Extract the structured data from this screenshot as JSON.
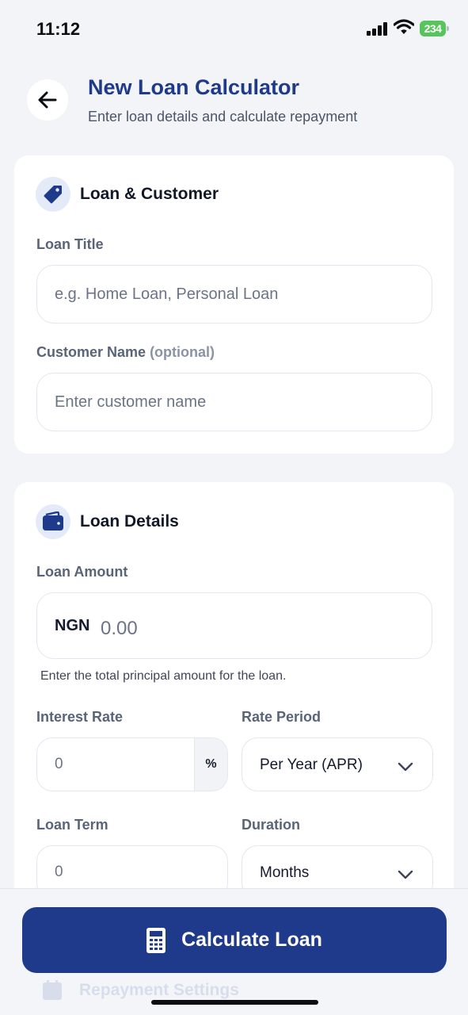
{
  "status_bar": {
    "time": "11:12",
    "battery": "234"
  },
  "header": {
    "title": "New Loan Calculator",
    "subtitle": "Enter loan details and calculate repayment",
    "back_icon": "arrow-left-icon"
  },
  "loan_customer": {
    "title": "Loan & Customer",
    "icon": "tag-icon",
    "loan_title_label": "Loan Title",
    "loan_title_placeholder": "e.g. Home Loan, Personal Loan",
    "customer_name_label": "Customer Name",
    "customer_name_optional": "(optional)",
    "customer_name_placeholder": "Enter customer name"
  },
  "loan_details": {
    "title": "Loan Details",
    "icon": "wallet-icon",
    "amount_label": "Loan Amount",
    "currency": "NGN",
    "amount_placeholder": "0.00",
    "amount_helper": "Enter the total principal amount for the loan.",
    "interest_rate_label": "Interest Rate",
    "interest_rate_placeholder": "0",
    "percent_symbol": "%",
    "rate_period_label": "Rate Period",
    "rate_period_value": "Per Year (APR)",
    "loan_term_label": "Loan Term",
    "loan_term_placeholder": "0",
    "duration_label": "Duration",
    "duration_value": "Months"
  },
  "repayment_settings": {
    "title": "Repayment Settings",
    "icon": "calendar-icon"
  },
  "actions": {
    "calculate_label": "Calculate Loan",
    "calculate_icon": "calculator-icon"
  },
  "colors": {
    "primary": "#1f3a8a",
    "background": "#f2f4f8",
    "card": "#ffffff",
    "icon_bg": "#e4eaf8"
  }
}
